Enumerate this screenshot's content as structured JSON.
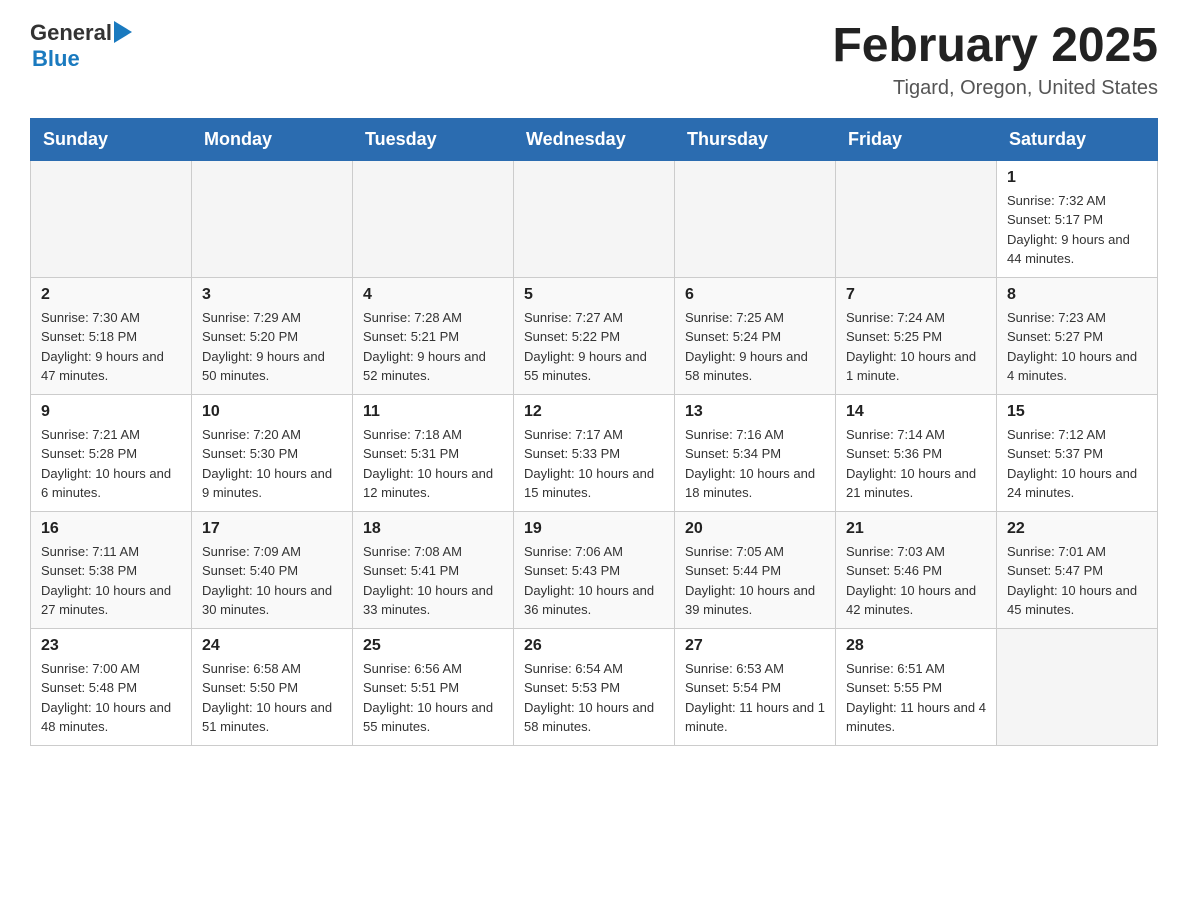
{
  "header": {
    "logo_general": "General",
    "logo_blue": "Blue",
    "month_title": "February 2025",
    "location": "Tigard, Oregon, United States"
  },
  "days_of_week": [
    "Sunday",
    "Monday",
    "Tuesday",
    "Wednesday",
    "Thursday",
    "Friday",
    "Saturday"
  ],
  "weeks": [
    [
      {
        "day": "",
        "info": ""
      },
      {
        "day": "",
        "info": ""
      },
      {
        "day": "",
        "info": ""
      },
      {
        "day": "",
        "info": ""
      },
      {
        "day": "",
        "info": ""
      },
      {
        "day": "",
        "info": ""
      },
      {
        "day": "1",
        "info": "Sunrise: 7:32 AM\nSunset: 5:17 PM\nDaylight: 9 hours and 44 minutes."
      }
    ],
    [
      {
        "day": "2",
        "info": "Sunrise: 7:30 AM\nSunset: 5:18 PM\nDaylight: 9 hours and 47 minutes."
      },
      {
        "day": "3",
        "info": "Sunrise: 7:29 AM\nSunset: 5:20 PM\nDaylight: 9 hours and 50 minutes."
      },
      {
        "day": "4",
        "info": "Sunrise: 7:28 AM\nSunset: 5:21 PM\nDaylight: 9 hours and 52 minutes."
      },
      {
        "day": "5",
        "info": "Sunrise: 7:27 AM\nSunset: 5:22 PM\nDaylight: 9 hours and 55 minutes."
      },
      {
        "day": "6",
        "info": "Sunrise: 7:25 AM\nSunset: 5:24 PM\nDaylight: 9 hours and 58 minutes."
      },
      {
        "day": "7",
        "info": "Sunrise: 7:24 AM\nSunset: 5:25 PM\nDaylight: 10 hours and 1 minute."
      },
      {
        "day": "8",
        "info": "Sunrise: 7:23 AM\nSunset: 5:27 PM\nDaylight: 10 hours and 4 minutes."
      }
    ],
    [
      {
        "day": "9",
        "info": "Sunrise: 7:21 AM\nSunset: 5:28 PM\nDaylight: 10 hours and 6 minutes."
      },
      {
        "day": "10",
        "info": "Sunrise: 7:20 AM\nSunset: 5:30 PM\nDaylight: 10 hours and 9 minutes."
      },
      {
        "day": "11",
        "info": "Sunrise: 7:18 AM\nSunset: 5:31 PM\nDaylight: 10 hours and 12 minutes."
      },
      {
        "day": "12",
        "info": "Sunrise: 7:17 AM\nSunset: 5:33 PM\nDaylight: 10 hours and 15 minutes."
      },
      {
        "day": "13",
        "info": "Sunrise: 7:16 AM\nSunset: 5:34 PM\nDaylight: 10 hours and 18 minutes."
      },
      {
        "day": "14",
        "info": "Sunrise: 7:14 AM\nSunset: 5:36 PM\nDaylight: 10 hours and 21 minutes."
      },
      {
        "day": "15",
        "info": "Sunrise: 7:12 AM\nSunset: 5:37 PM\nDaylight: 10 hours and 24 minutes."
      }
    ],
    [
      {
        "day": "16",
        "info": "Sunrise: 7:11 AM\nSunset: 5:38 PM\nDaylight: 10 hours and 27 minutes."
      },
      {
        "day": "17",
        "info": "Sunrise: 7:09 AM\nSunset: 5:40 PM\nDaylight: 10 hours and 30 minutes."
      },
      {
        "day": "18",
        "info": "Sunrise: 7:08 AM\nSunset: 5:41 PM\nDaylight: 10 hours and 33 minutes."
      },
      {
        "day": "19",
        "info": "Sunrise: 7:06 AM\nSunset: 5:43 PM\nDaylight: 10 hours and 36 minutes."
      },
      {
        "day": "20",
        "info": "Sunrise: 7:05 AM\nSunset: 5:44 PM\nDaylight: 10 hours and 39 minutes."
      },
      {
        "day": "21",
        "info": "Sunrise: 7:03 AM\nSunset: 5:46 PM\nDaylight: 10 hours and 42 minutes."
      },
      {
        "day": "22",
        "info": "Sunrise: 7:01 AM\nSunset: 5:47 PM\nDaylight: 10 hours and 45 minutes."
      }
    ],
    [
      {
        "day": "23",
        "info": "Sunrise: 7:00 AM\nSunset: 5:48 PM\nDaylight: 10 hours and 48 minutes."
      },
      {
        "day": "24",
        "info": "Sunrise: 6:58 AM\nSunset: 5:50 PM\nDaylight: 10 hours and 51 minutes."
      },
      {
        "day": "25",
        "info": "Sunrise: 6:56 AM\nSunset: 5:51 PM\nDaylight: 10 hours and 55 minutes."
      },
      {
        "day": "26",
        "info": "Sunrise: 6:54 AM\nSunset: 5:53 PM\nDaylight: 10 hours and 58 minutes."
      },
      {
        "day": "27",
        "info": "Sunrise: 6:53 AM\nSunset: 5:54 PM\nDaylight: 11 hours and 1 minute."
      },
      {
        "day": "28",
        "info": "Sunrise: 6:51 AM\nSunset: 5:55 PM\nDaylight: 11 hours and 4 minutes."
      },
      {
        "day": "",
        "info": ""
      }
    ]
  ]
}
